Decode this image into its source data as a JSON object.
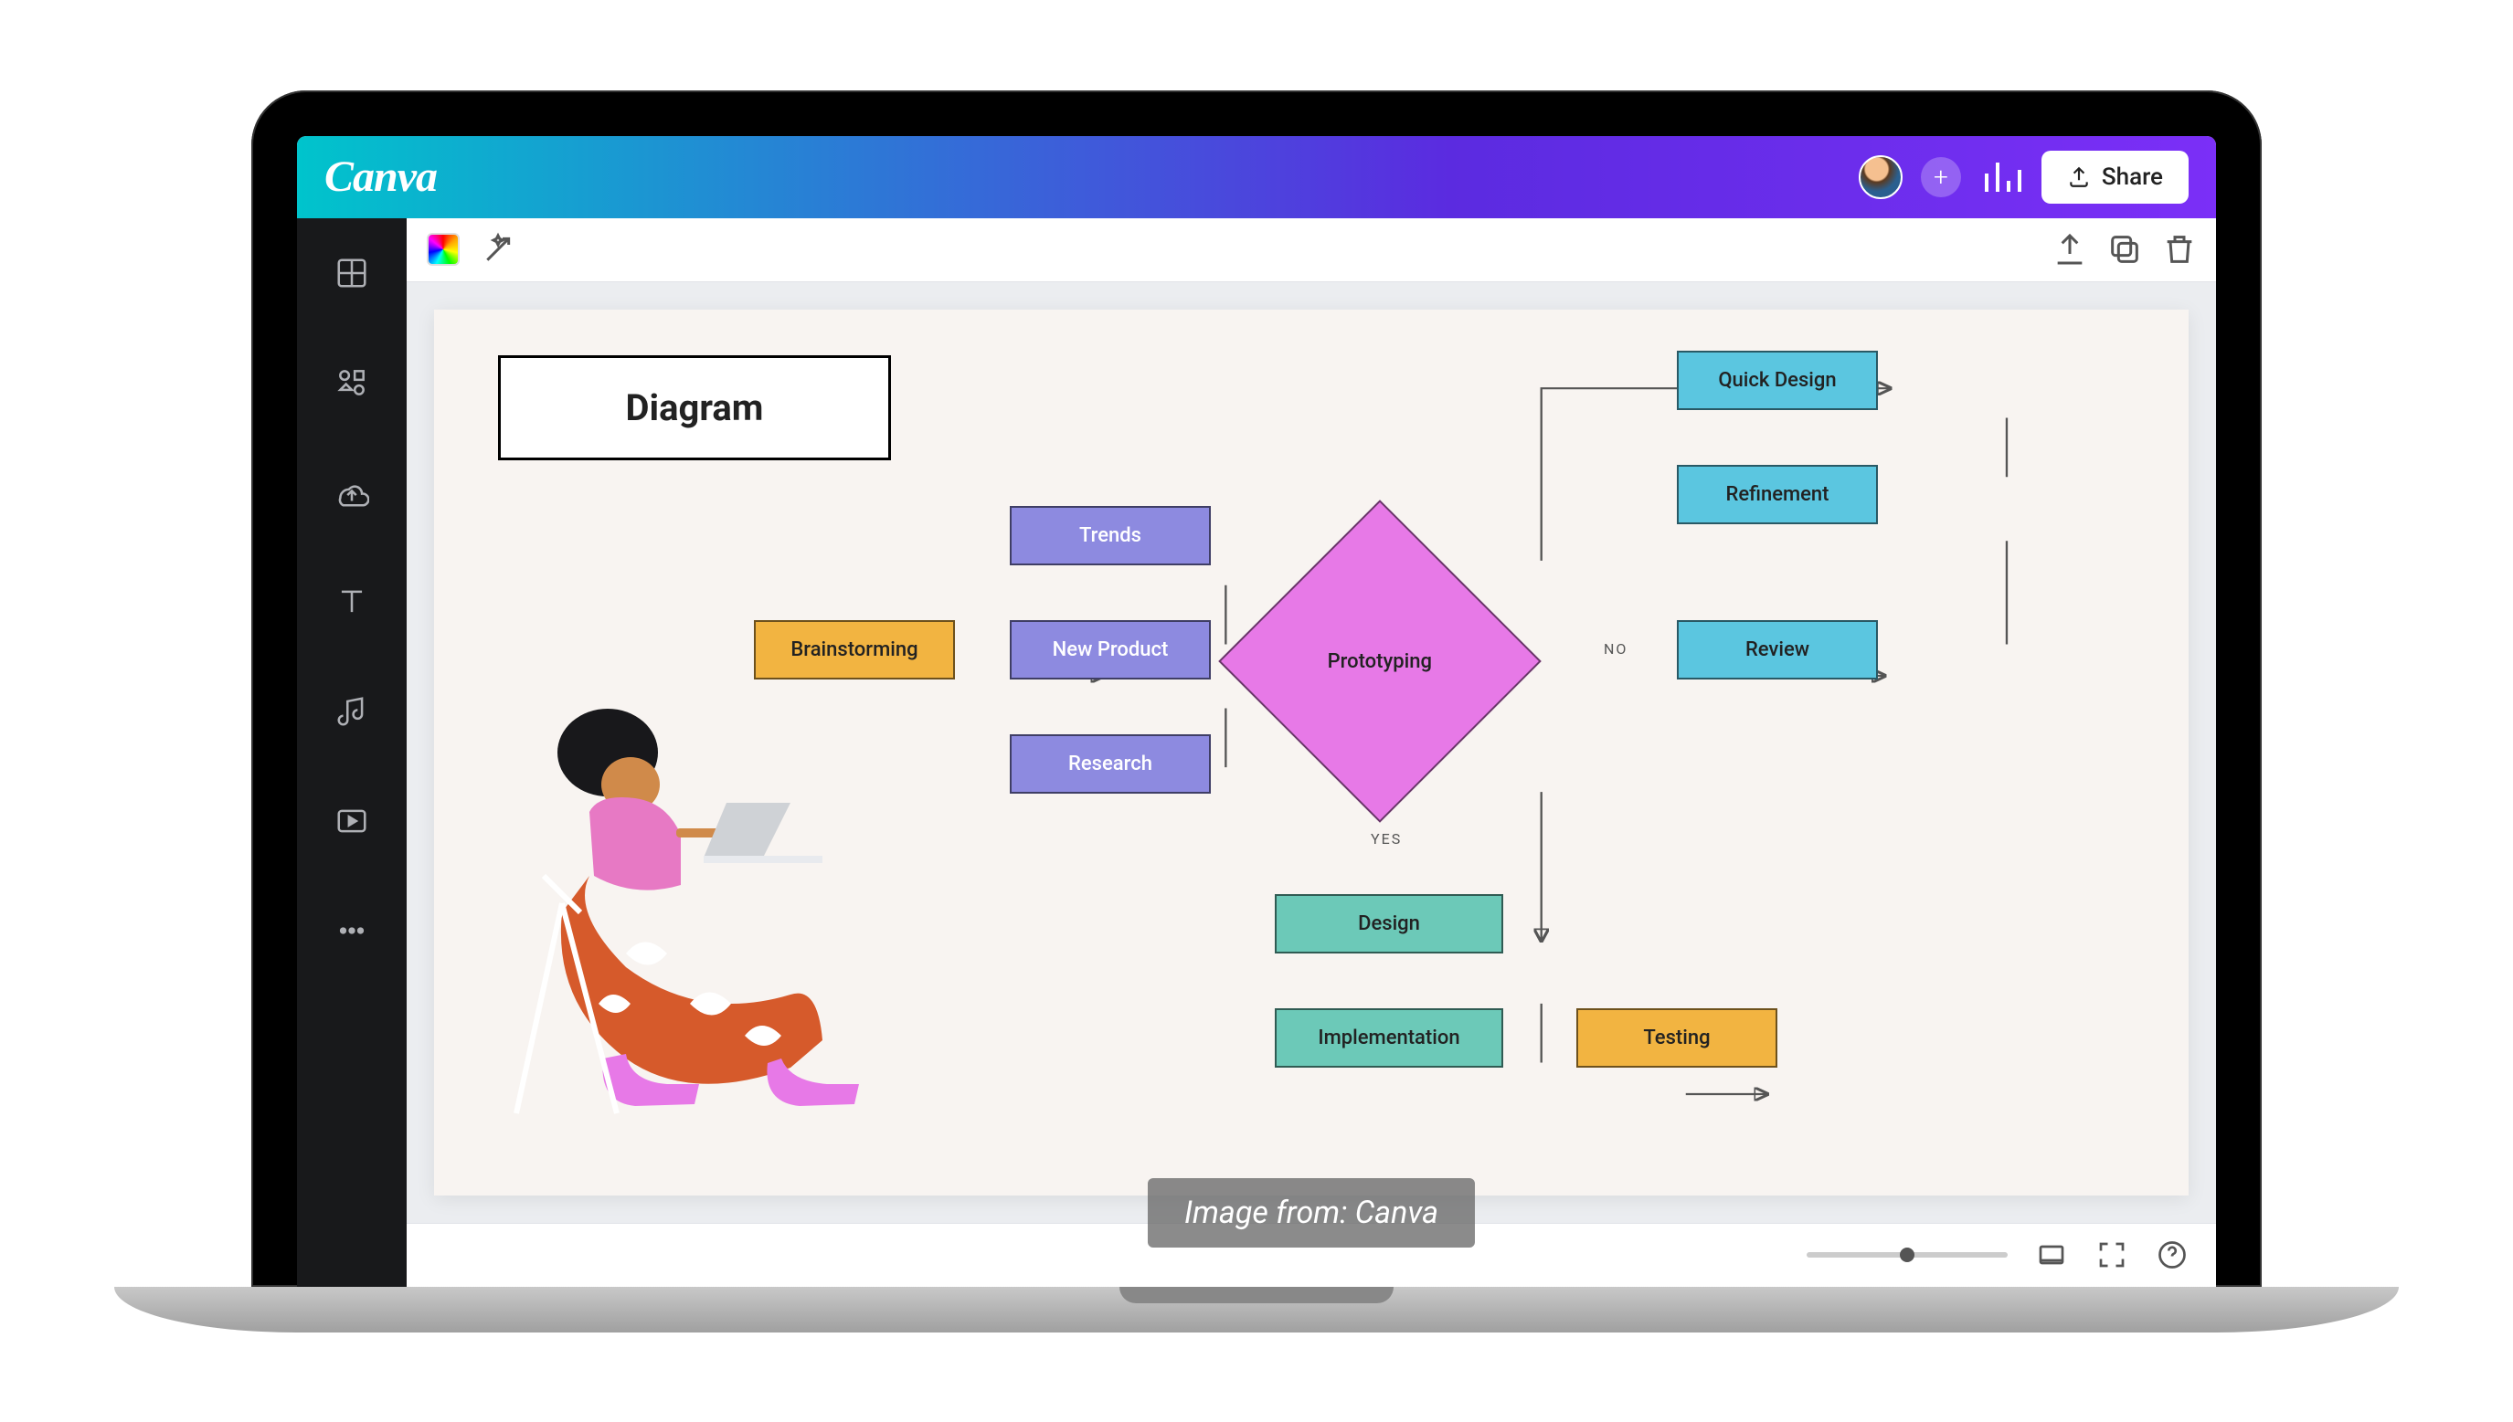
{
  "app": {
    "logo": "Canva"
  },
  "header": {
    "share_label": "Share"
  },
  "diagram": {
    "title": "Diagram",
    "nodes": {
      "brainstorming": "Brainstorming",
      "trends": "Trends",
      "new_product": "New Product",
      "research": "Research",
      "prototyping": "Prototyping",
      "quick_design": "Quick Design",
      "refinement": "Refinement",
      "review": "Review",
      "design": "Design",
      "implementation": "Implementation",
      "testing": "Testing"
    },
    "edge_labels": {
      "no": "NO",
      "yes": "YES"
    }
  },
  "caption": "Image from: Canva",
  "colors": {
    "orange": "#f2b441",
    "purple": "#8d8ae0",
    "pink": "#e779e7",
    "cyan": "#5bc6e0",
    "teal": "#6cc9b8"
  }
}
